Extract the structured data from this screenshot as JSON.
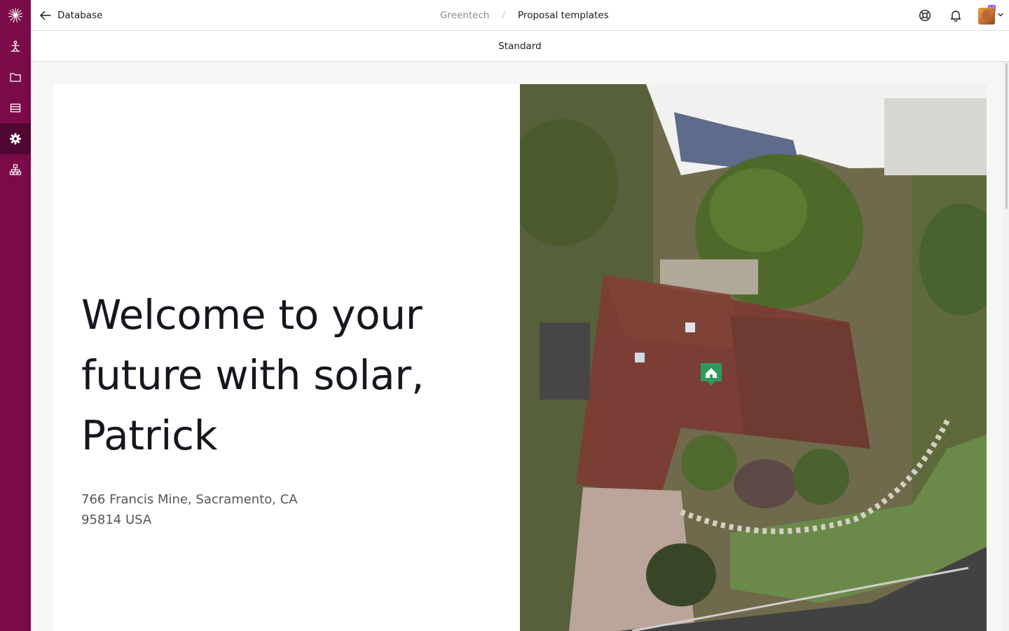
{
  "topbar": {
    "back_label": "Database",
    "breadcrumb": [
      "Greentech",
      "Proposal templates"
    ],
    "notification_count": "12"
  },
  "subbar": {
    "title": "Standard"
  },
  "sidebar": {
    "logo": "sunburst-logo",
    "items": [
      {
        "icon": "person-icon",
        "active": false
      },
      {
        "icon": "folder-icon",
        "active": false
      },
      {
        "icon": "table-icon",
        "active": false
      },
      {
        "icon": "gear-icon",
        "active": true
      },
      {
        "icon": "org-chart-icon",
        "active": false
      }
    ]
  },
  "proposal": {
    "headline_line1": "Welcome to your",
    "headline_line2": "future with solar,",
    "headline_line3": "Patrick",
    "address_line1": "766 Francis Mine, Sacramento, CA",
    "address_line2": "95814 USA"
  },
  "colors": {
    "sidebar_bg": "#7a0a48",
    "sidebar_active": "#500630",
    "badge": "#8b5cf6",
    "map_pin": "#2e9a5f"
  }
}
